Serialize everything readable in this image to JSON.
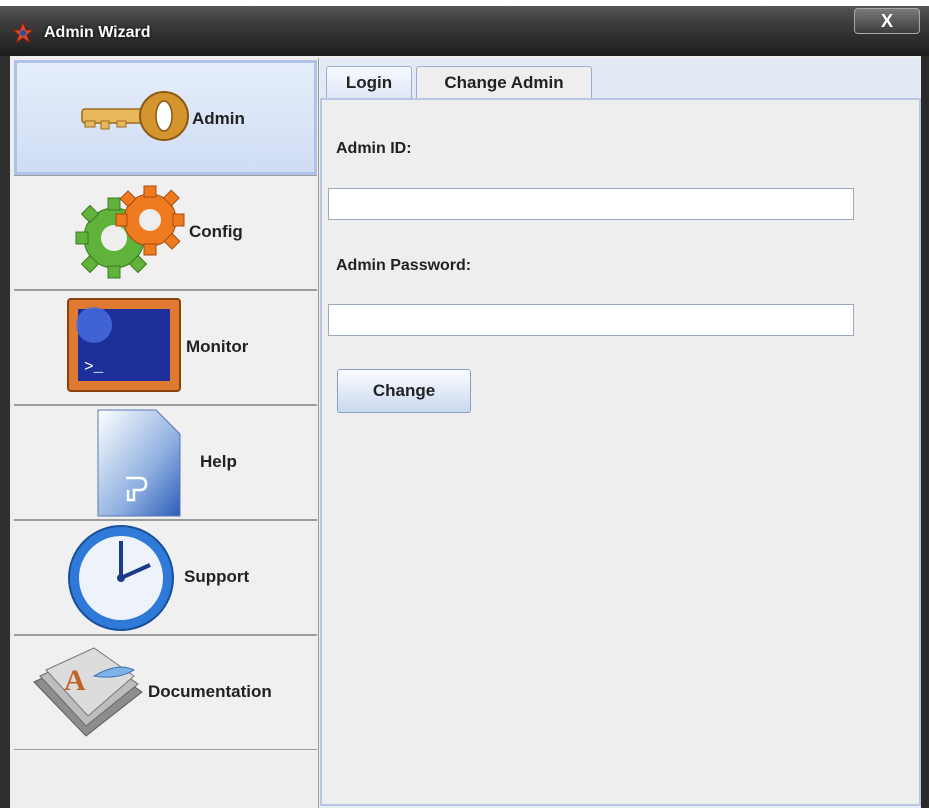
{
  "window": {
    "title": "Admin Wizard",
    "close_label": "X",
    "accent_color": "#aec3e6"
  },
  "sidebar": {
    "items": [
      {
        "label": "Admin",
        "icon": "key-icon",
        "selected": true
      },
      {
        "label": "Config",
        "icon": "gears-icon",
        "selected": false
      },
      {
        "label": "Monitor",
        "icon": "monitor-icon",
        "selected": false
      },
      {
        "label": "Help",
        "icon": "help-document-icon",
        "selected": false
      },
      {
        "label": "Support",
        "icon": "clock-icon",
        "selected": false
      },
      {
        "label": "Documentation",
        "icon": "documents-icon",
        "selected": false
      }
    ]
  },
  "tabs": [
    {
      "label": "Login",
      "active": false
    },
    {
      "label": "Change Admin",
      "active": true
    }
  ],
  "form": {
    "admin_id_label": "Admin ID:",
    "admin_id_value": "",
    "admin_password_label": "Admin Password:",
    "admin_password_value": "",
    "change_button_label": "Change"
  }
}
